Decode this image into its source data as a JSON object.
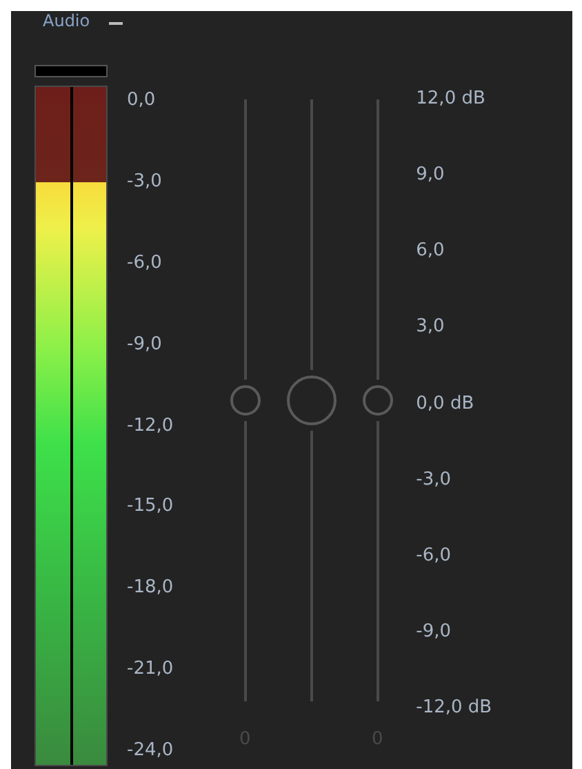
{
  "panel": {
    "title": "Audio"
  },
  "meter": {
    "channels": [
      {
        "level": 0.86
      },
      {
        "level": 0.86
      }
    ]
  },
  "meter_scale": [
    "0,0",
    "-3,0",
    "-6,0",
    "-9,0",
    "-12,0",
    "-15,0",
    "-18,0",
    "-21,0",
    "-24,0"
  ],
  "sliders": [
    {
      "kind": "small",
      "level": 0.5,
      "readout": "0"
    },
    {
      "kind": "large",
      "level": 0.5
    },
    {
      "kind": "small",
      "level": 0.5,
      "readout": "0"
    }
  ],
  "gain_scale": [
    "12,0 dB",
    "9,0",
    "6,0",
    "3,0",
    "0,0 dB",
    "-3,0",
    "-6,0",
    "-9,0",
    "-12,0 dB"
  ]
}
